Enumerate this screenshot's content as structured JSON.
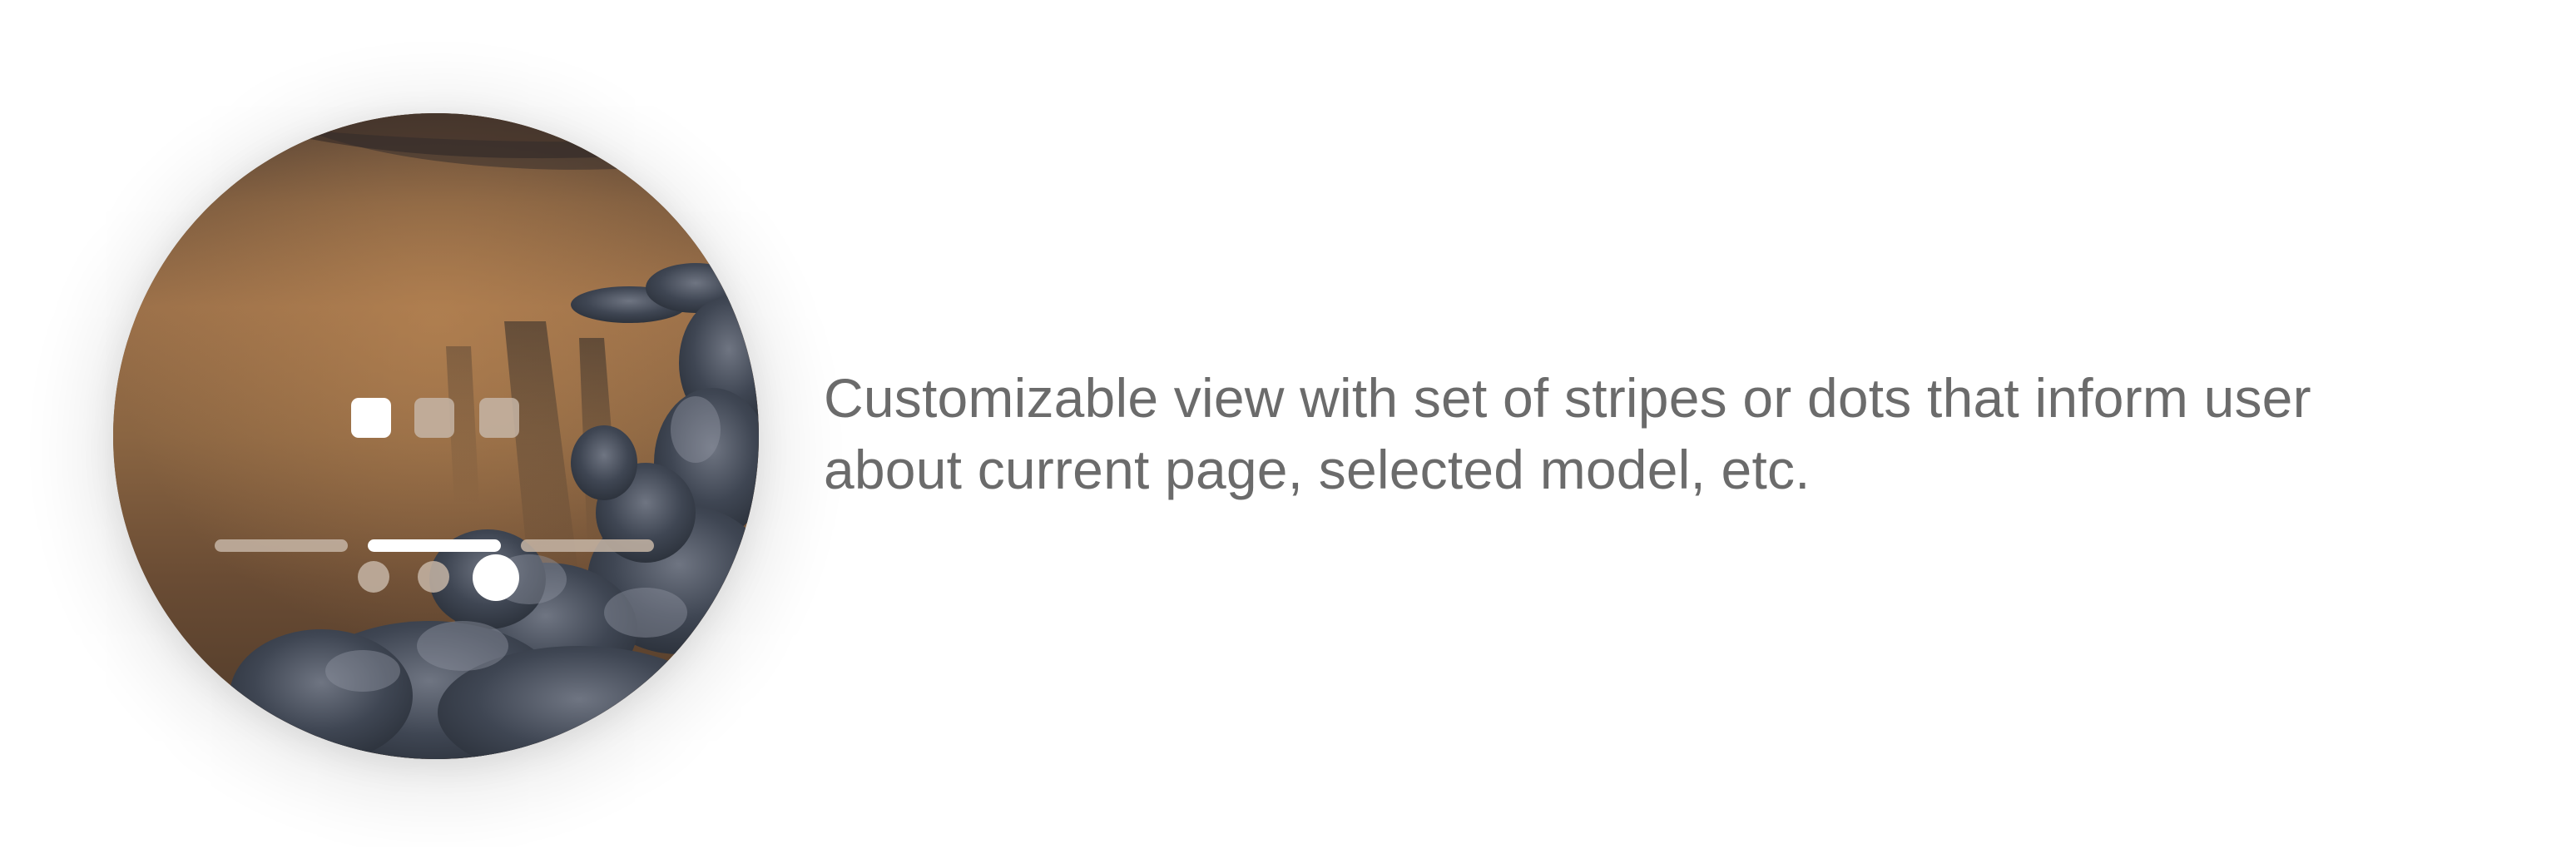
{
  "caption": {
    "line1": "Customizable view with set of stripes or dots that inform user",
    "line2": "about current page, selected model, etc."
  },
  "page_indicators": {
    "squares": {
      "count": 3,
      "active_index": 0
    },
    "stripes": {
      "count": 3,
      "active_index": 1
    },
    "dots": {
      "count": 3,
      "active_index": 2
    }
  },
  "colors": {
    "active": "#ffffff",
    "inactive": "#c6b5a6",
    "caption_text": "#6b6b6b"
  }
}
